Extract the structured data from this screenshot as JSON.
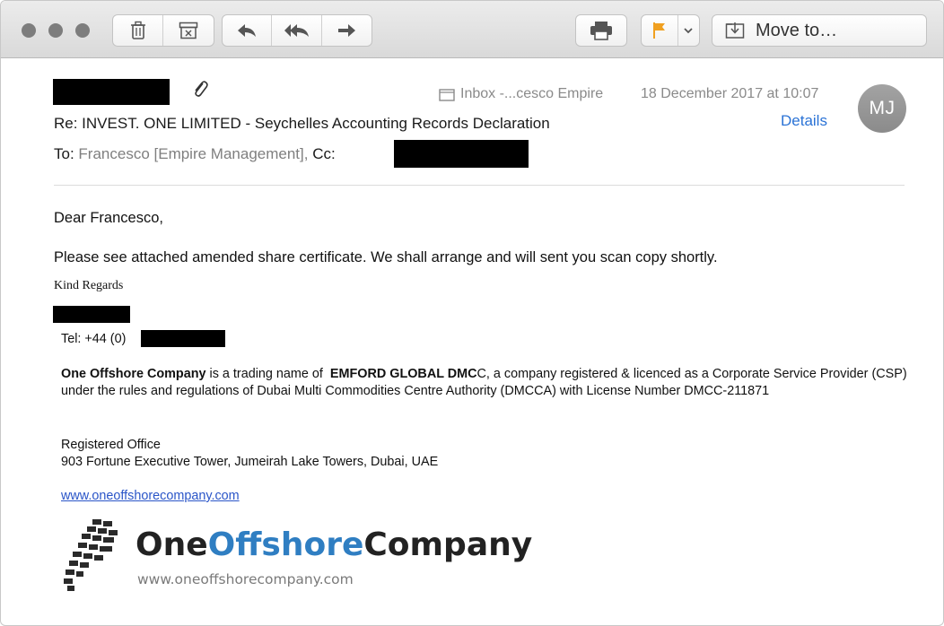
{
  "toolbar": {
    "move_label": "Move to…",
    "flag_color": "#f0a020"
  },
  "message": {
    "mailbox": "Inbox -...cesco Empire",
    "date": "18 December 2017 at 10:07",
    "subject": "Re: INVEST. ONE LIMITED - Seychelles Accounting Records Declaration",
    "details_label": "Details",
    "avatar_initials": "MJ",
    "to_label": "To:",
    "to_value": "Francesco [Empire Management],",
    "cc_label": "Cc:"
  },
  "body": {
    "greeting": "Dear Francesco,",
    "paragraph": "Please see attached amended share certificate. We shall arrange and will sent you scan copy shortly.",
    "kind_regards": "Kind Regards"
  },
  "signature": {
    "tel_label": "Tel: +44 (0)",
    "company_name": "One Offshore Company",
    "company_text_1": " is a trading name of  ",
    "company_legal_bold": "EMFORD GLOBAL DMC",
    "company_legal_rest": "C, a company registered & licenced as a Corporate Service Provider (CSP) under the rules and regulations of Dubai Multi Commodities Centre Authority (DMCCA) with License Number DMCC-211871",
    "office_heading": "Registered Office",
    "office_address": "903 Fortune Executive Tower, Jumeirah Lake Towers, Dubai, UAE",
    "website": "www.oneoffshorecompany.com"
  },
  "logo": {
    "word_one": "One",
    "word_offshore": "Offshore",
    "word_company": "Company",
    "url": "www.oneoffshorecompany.com"
  }
}
